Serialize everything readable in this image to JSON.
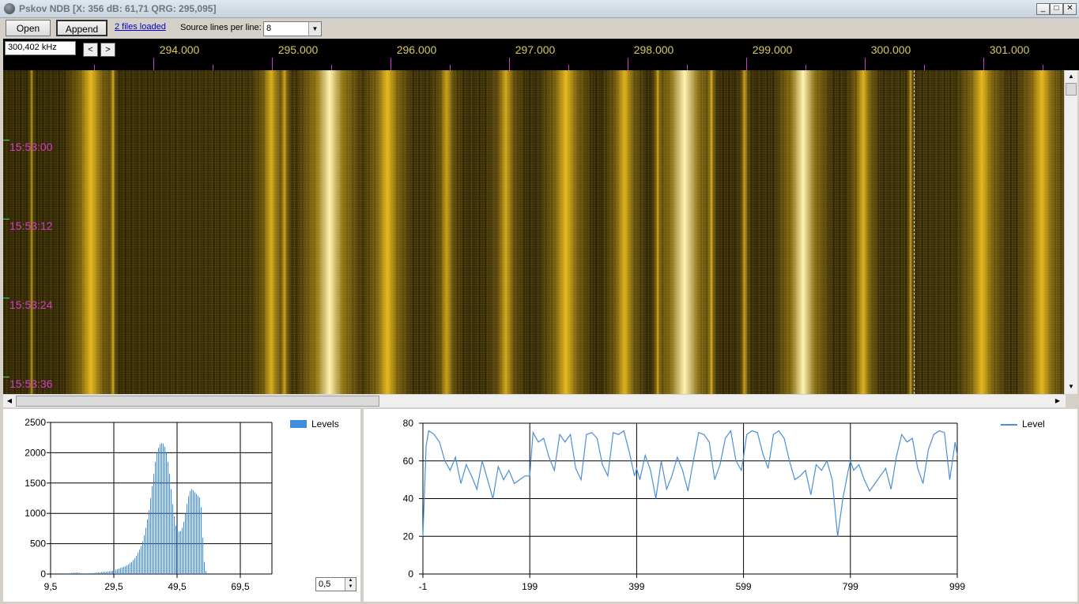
{
  "window": {
    "title": "Pskov NDB [X: 356 dB: 61,71 QRG: 295,095]",
    "min_label": "_",
    "max_label": "□",
    "close_label": "✕"
  },
  "toolbar": {
    "open_label": "Open",
    "append_label": "Append",
    "files_link": "2 files loaded",
    "source_lines_label": "Source lines per line:",
    "source_lines_value": "8"
  },
  "scale": {
    "frequency_value": "300,402 kHz",
    "prev_label": "<",
    "next_label": ">",
    "ticks": [
      "294.000",
      "295.000",
      "296.000",
      "297.000",
      "298.000",
      "299.000",
      "300.000",
      "301.000"
    ]
  },
  "waterfall": {
    "time_labels": [
      "15:53:00",
      "15:53:12",
      "15:53:24",
      "15:53:36"
    ],
    "colors": {
      "background": "#3a2f08",
      "signal": "#f0c020",
      "peak": "#fff3b0"
    }
  },
  "histogram": {
    "legend": "Levels",
    "spin_value": "0,5",
    "chart_data": {
      "type": "bar",
      "title": "",
      "xlabel": "",
      "ylabel": "",
      "x_ticks": [
        "9,5",
        "29,5",
        "49,5",
        "69,5"
      ],
      "y_ticks": [
        "0",
        "500",
        "1000",
        "1500",
        "2000",
        "2500"
      ],
      "xlim": [
        9.5,
        79.5
      ],
      "ylim": [
        0,
        2500
      ],
      "bin_start": 14.0,
      "bin_width": 0.5,
      "series": [
        {
          "name": "Levels",
          "color": "#3f8ddc"
        }
      ],
      "values": [
        10,
        12,
        14,
        15,
        18,
        20,
        22,
        25,
        22,
        18,
        15,
        12,
        10,
        10,
        12,
        14,
        15,
        16,
        18,
        20,
        22,
        25,
        28,
        30,
        32,
        35,
        38,
        40,
        45,
        50,
        55,
        60,
        70,
        80,
        90,
        100,
        110,
        120,
        130,
        145,
        160,
        180,
        200,
        230,
        260,
        300,
        350,
        400,
        460,
        540,
        640,
        760,
        900,
        1050,
        1250,
        1450,
        1650,
        1850,
        2000,
        2080,
        2140,
        2160,
        2150,
        2100,
        2000,
        1850,
        1650,
        1400,
        1150,
        950,
        800,
        720,
        700,
        710,
        760,
        860,
        1000,
        1150,
        1280,
        1370,
        1400,
        1380,
        1350,
        1320,
        1290,
        1260,
        1100,
        600,
        200,
        50
      ]
    }
  },
  "level_chart": {
    "legend": "Level",
    "chart_data": {
      "type": "line",
      "title": "",
      "xlabel": "",
      "ylabel": "",
      "x_ticks": [
        "-1",
        "199",
        "399",
        "599",
        "799",
        "999"
      ],
      "y_ticks": [
        "0",
        "20",
        "40",
        "60",
        "80"
      ],
      "xlim": [
        -1,
        999
      ],
      "ylim": [
        0,
        80
      ],
      "series": [
        {
          "name": "Level",
          "color": "#4a8fd8"
        }
      ],
      "x": [
        -1,
        5,
        10,
        20,
        30,
        40,
        50,
        60,
        70,
        80,
        90,
        100,
        110,
        120,
        130,
        140,
        150,
        160,
        170,
        180,
        190,
        199,
        205,
        215,
        225,
        235,
        245,
        255,
        265,
        275,
        285,
        295,
        305,
        315,
        325,
        335,
        345,
        355,
        365,
        375,
        385,
        395,
        399,
        405,
        415,
        425,
        435,
        445,
        455,
        465,
        475,
        485,
        495,
        505,
        515,
        525,
        535,
        545,
        555,
        565,
        575,
        585,
        595,
        599,
        605,
        615,
        625,
        635,
        645,
        655,
        665,
        675,
        685,
        695,
        705,
        715,
        725,
        735,
        745,
        755,
        765,
        775,
        785,
        795,
        799,
        805,
        815,
        825,
        835,
        845,
        855,
        865,
        875,
        885,
        895,
        905,
        915,
        925,
        935,
        945,
        955,
        965,
        975,
        985,
        995,
        999
      ],
      "values": [
        20,
        68,
        76,
        74,
        70,
        60,
        55,
        62,
        48,
        58,
        52,
        45,
        60,
        50,
        40,
        57,
        50,
        55,
        48,
        50,
        52,
        52,
        75,
        70,
        72,
        62,
        55,
        74,
        70,
        74,
        56,
        50,
        74,
        75,
        72,
        58,
        52,
        75,
        74,
        76,
        65,
        52,
        56,
        50,
        63,
        55,
        40,
        60,
        45,
        52,
        62,
        55,
        44,
        60,
        75,
        74,
        70,
        50,
        58,
        72,
        76,
        60,
        55,
        62,
        74,
        76,
        75,
        64,
        56,
        74,
        76,
        72,
        60,
        50,
        52,
        55,
        42,
        58,
        55,
        60,
        50,
        20,
        40,
        55,
        60,
        55,
        58,
        50,
        44,
        48,
        52,
        56,
        45,
        62,
        74,
        70,
        72,
        56,
        48,
        66,
        74,
        76,
        75,
        50,
        70,
        63
      ]
    }
  }
}
